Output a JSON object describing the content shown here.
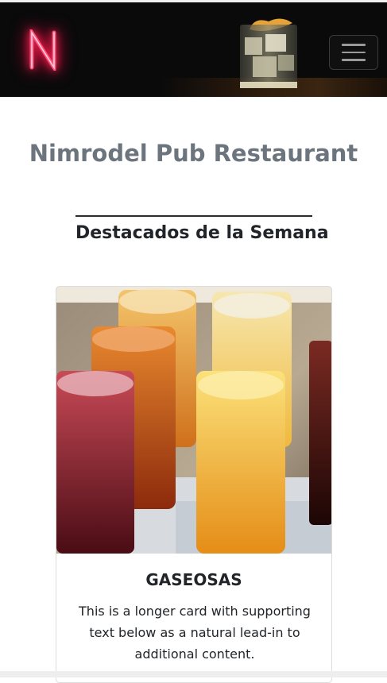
{
  "header": {
    "logo_letter": "N",
    "logo_color": "#ff2d6a",
    "menu_icon": "hamburger-menu-icon"
  },
  "main": {
    "site_title": "Nimrodel Pub Restaurant",
    "section_title": "Destacados de la Semana"
  },
  "card": {
    "image_icon": "soft-drinks-glasses-image",
    "title": "GASEOSAS",
    "text": "This is a longer card with supporting text below as a natural lead-in to additional content."
  },
  "colors": {
    "navbar_bg": "#0a0a0b",
    "title_gray": "#6c757d",
    "text_dark": "#212529"
  }
}
